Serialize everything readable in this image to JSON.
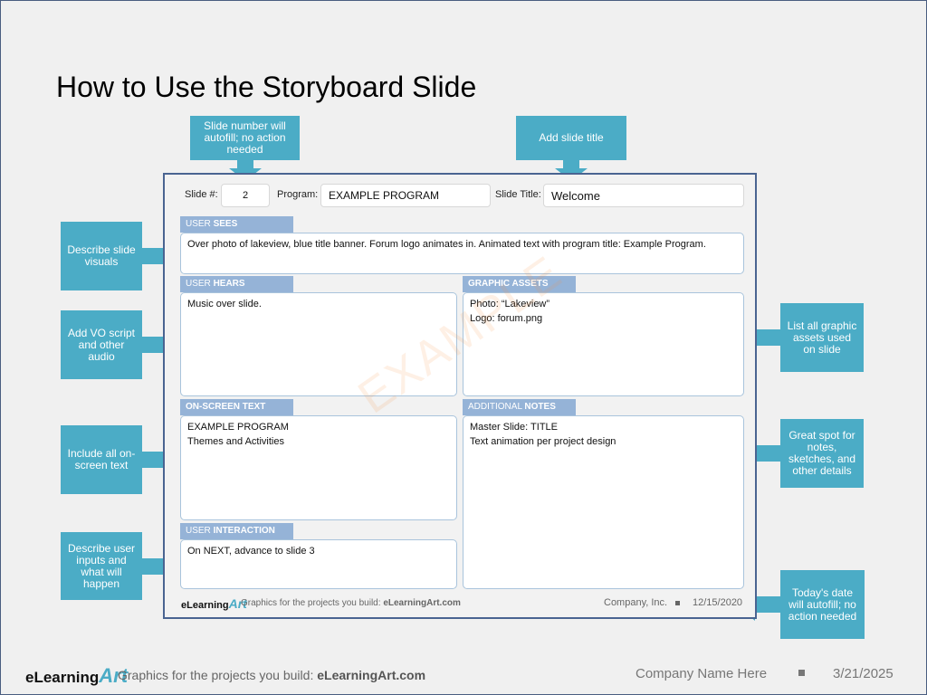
{
  "title": "How to Use the Storyboard Slide",
  "callouts": {
    "slide_number": "Slide number will autofill; no action needed",
    "slide_title": "Add slide title",
    "visuals": "Describe slide visuals",
    "vo": "Add VO script and other audio",
    "onscreen": "Include all on-screen text",
    "inputs": "Describe user inputs and what will happen",
    "assets": "List all graphic assets used on slide",
    "notes": "Great spot for notes, sketches, and other details",
    "date": "Today's date will autofill; no action needed"
  },
  "storyboard": {
    "slide_num_label": "Slide #:",
    "slide_num": "2",
    "program_label": "Program:",
    "program": "EXAMPLE PROGRAM",
    "slide_title_label": "Slide Title:",
    "slide_title": "Welcome",
    "sees_tab_pre": "USER ",
    "sees_tab_bold": "SEES",
    "sees_text": "Over photo of lakeview, blue title banner. Forum logo animates in. Animated text with program title: Example Program.",
    "hears_tab_pre": "USER ",
    "hears_tab_bold": "HEARS",
    "hears_text": "Music over slide.",
    "assets_tab": "GRAPHIC ASSETS",
    "assets_line1": "Photo: “Lakeview”",
    "assets_line2": "Logo: forum.png",
    "onscreen_tab": "ON-SCREEN TEXT",
    "onscreen_line1": "EXAMPLE PROGRAM",
    "onscreen_line2": "Themes and Activities",
    "notes_tab_pre": "ADDITIONAL ",
    "notes_tab_bold": "NOTES",
    "notes_line1": "Master Slide: TITLE",
    "notes_line2": "Text animation per project design",
    "interaction_tab_pre": "USER ",
    "interaction_tab_bold": "INTERACTION",
    "interaction_text": "On NEXT, advance to slide 3",
    "watermark": "EXAMPLE",
    "footer_logo_text": "eLearning",
    "footer_logo_art": "Art",
    "footer_tagline": "Graphics for the projects you build: ",
    "footer_tagline_bold": "eLearningArt.com",
    "footer_company": "Company, Inc.",
    "footer_date": "12/15/2020"
  },
  "footer": {
    "logo_text": "eLearning",
    "logo_art": "Art",
    "tagline": "Graphics for the projects you build: ",
    "tagline_bold": "eLearningArt.com",
    "company": "Company Name Here",
    "date": "3/21/2025"
  },
  "colors": {
    "callout": "#4bacc6",
    "tab": "#95b3d7",
    "border": "#4a6491"
  }
}
